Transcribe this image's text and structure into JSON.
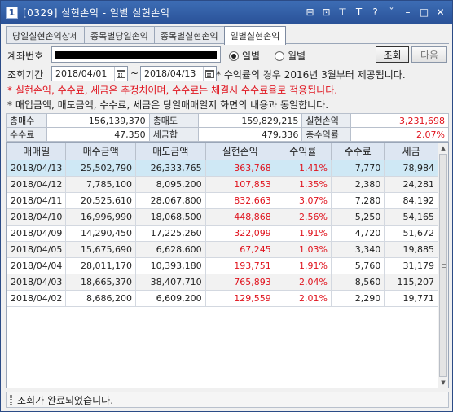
{
  "window": {
    "number": "1",
    "title": "[0329] 실현손익 - 일별 실현손익",
    "buttons": [
      "⊟",
      "⊡",
      "⊤",
      "T",
      "?",
      "ˇ",
      "–",
      "□",
      "✕"
    ]
  },
  "tabs": [
    {
      "label": "당일실현손익상세",
      "active": false
    },
    {
      "label": "종목별당일손익",
      "active": false
    },
    {
      "label": "종목별실현손익",
      "active": false
    },
    {
      "label": "일별실현손익",
      "active": true
    }
  ],
  "form": {
    "account_label": "계좌번호",
    "period_label": "조회기간",
    "date_from": "2018/04/01",
    "tilde": "~",
    "date_to": "2018/04/13",
    "radio_daily": "일별",
    "radio_monthly": "월별",
    "query_button": "조회",
    "next_button": "다음",
    "notice": "* 수익률의 경우 2016년 3월부터 제공됩니다.",
    "note_red": "* 실현손익, 수수료, 세금은 추정치이며, 수수료는 체결시 수수료율로 적용됩니다.",
    "note_black": "* 매입금액, 매도금액, 수수료, 세금은 당일매매일지 화면의 내용과 동일합니다."
  },
  "summary": {
    "row1": [
      {
        "label": "총매수",
        "value": "156,139,370"
      },
      {
        "label": "총매도",
        "value": "159,829,215"
      },
      {
        "label": "실현손익",
        "value": "3,231,698"
      }
    ],
    "row2": [
      {
        "label": "수수료",
        "value": "47,350"
      },
      {
        "label": "세금합",
        "value": "479,336"
      },
      {
        "label": "총수익률",
        "value": "2.07%"
      }
    ]
  },
  "grid": {
    "headers": [
      "매매일",
      "매수금액",
      "매도금액",
      "실현손익",
      "수익률",
      "수수료",
      "세금"
    ],
    "rows": [
      [
        "2018/04/13",
        "25,502,790",
        "26,333,765",
        "363,768",
        "1.41%",
        "7,770",
        "78,984"
      ],
      [
        "2018/04/12",
        "7,785,100",
        "8,095,200",
        "107,853",
        "1.35%",
        "2,380",
        "24,281"
      ],
      [
        "2018/04/11",
        "20,525,610",
        "28,067,800",
        "832,663",
        "3.07%",
        "7,280",
        "84,192"
      ],
      [
        "2018/04/10",
        "16,996,990",
        "18,068,500",
        "448,868",
        "2.56%",
        "5,250",
        "54,165"
      ],
      [
        "2018/04/09",
        "14,290,450",
        "17,225,260",
        "322,099",
        "1.91%",
        "4,720",
        "51,672"
      ],
      [
        "2018/04/05",
        "15,675,690",
        "6,628,600",
        "67,245",
        "1.03%",
        "3,340",
        "19,885"
      ],
      [
        "2018/04/04",
        "28,011,170",
        "10,393,180",
        "193,751",
        "1.91%",
        "5,760",
        "31,179"
      ],
      [
        "2018/04/03",
        "18,665,370",
        "38,407,710",
        "765,893",
        "2.04%",
        "8,560",
        "115,207"
      ],
      [
        "2018/04/02",
        "8,686,200",
        "6,609,200",
        "129,559",
        "2.01%",
        "2,290",
        "19,771"
      ]
    ]
  },
  "status": {
    "message": "조회가 완료되었습니다."
  },
  "colors": {
    "profit": "#e0141e",
    "selected_row": "#cfe8f5",
    "title_bar": "#2a5298"
  }
}
